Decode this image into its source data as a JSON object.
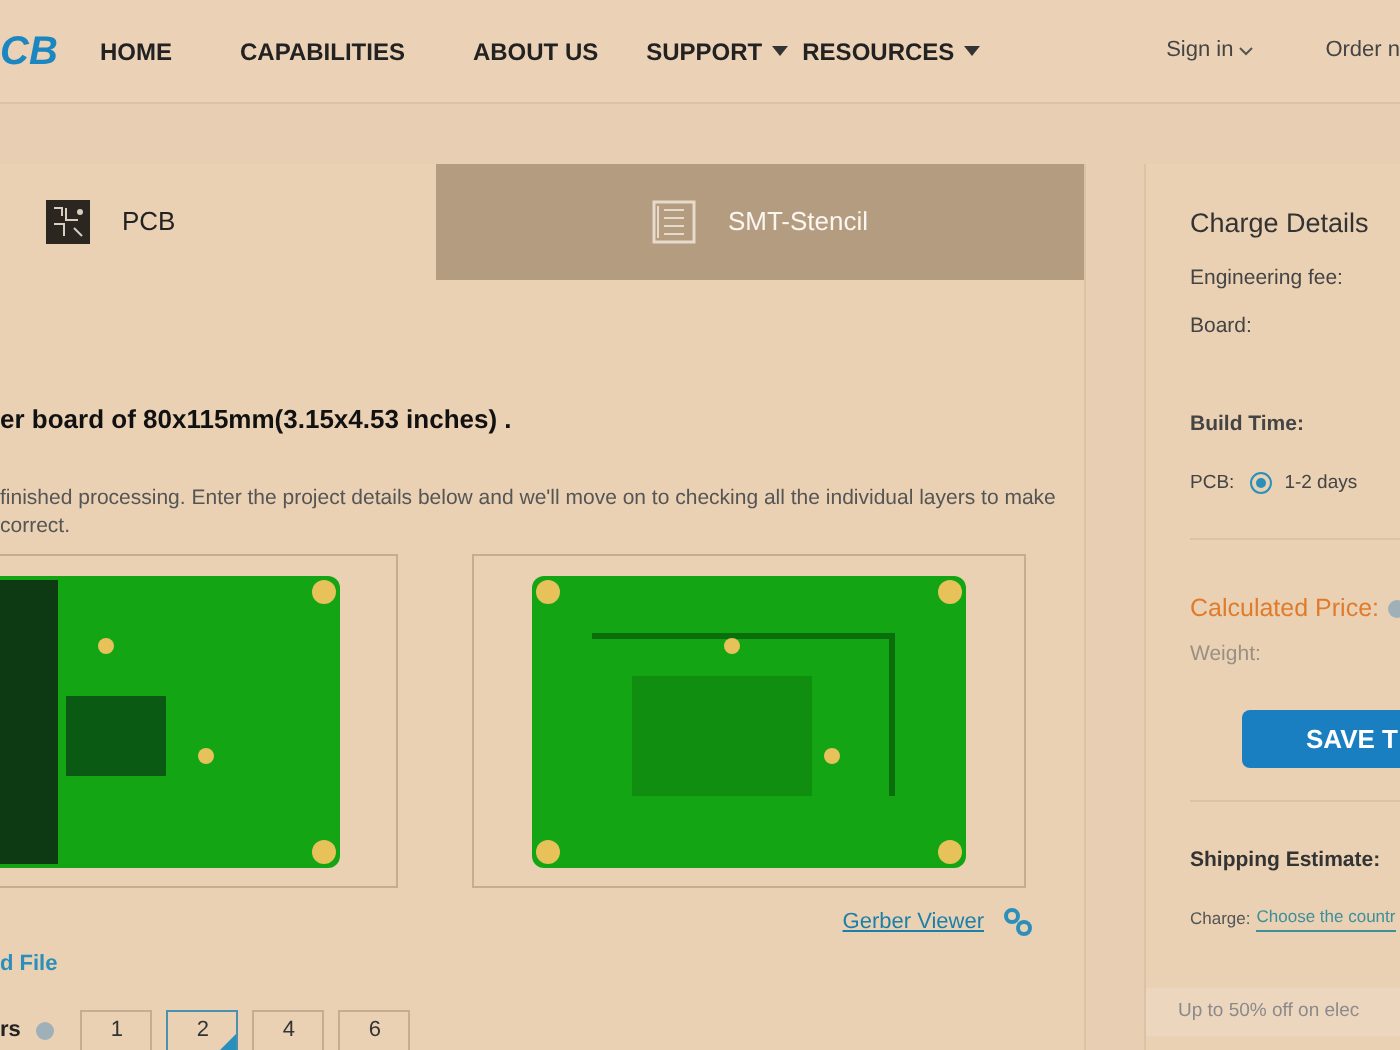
{
  "nav": {
    "logo": "CB",
    "items": [
      {
        "label": "HOME",
        "dropdown": false
      },
      {
        "label": "CAPABILITIES",
        "dropdown": false
      },
      {
        "label": "ABOUT US",
        "dropdown": false
      },
      {
        "label": "SUPPORT",
        "dropdown": true
      },
      {
        "label": "RESOURCES",
        "dropdown": true
      }
    ],
    "account": [
      {
        "label": "Sign in",
        "dropdown": true
      },
      {
        "label": "Order n",
        "dropdown": false
      }
    ]
  },
  "tabs": [
    {
      "label": "PCB",
      "selected": true
    },
    {
      "label": "SMT-Stencil",
      "selected": false
    }
  ],
  "content": {
    "heading": "er board of 80x115mm(3.15x4.53 inches) .",
    "description": [
      "finished processing. Enter the project details below and we'll move on to checking all the individual layers to make",
      "correct."
    ],
    "gerber_link": "Gerber Viewer",
    "upload_link": "d File",
    "layers": {
      "label": "rs",
      "options": [
        {
          "label": "1",
          "selected": false
        },
        {
          "label": "2",
          "selected": true
        },
        {
          "label": "4",
          "selected": false
        },
        {
          "label": "6",
          "selected": false
        }
      ]
    }
  },
  "charge": {
    "title": "Charge Details",
    "fees": [
      "Engineering fee:",
      "Board:"
    ],
    "build_time": "Build Time:",
    "pcb_label": "PCB:",
    "build_option": {
      "label": "1-2 days",
      "selected": true
    },
    "price_label": "Calculated Price:",
    "weight": "Weight:",
    "save_button": "SAVE T",
    "shipping": "Shipping Estimate:",
    "charge_label": "Charge:",
    "charge_link": "Choose the countr",
    "promo": "Up to 50% off on elec"
  }
}
